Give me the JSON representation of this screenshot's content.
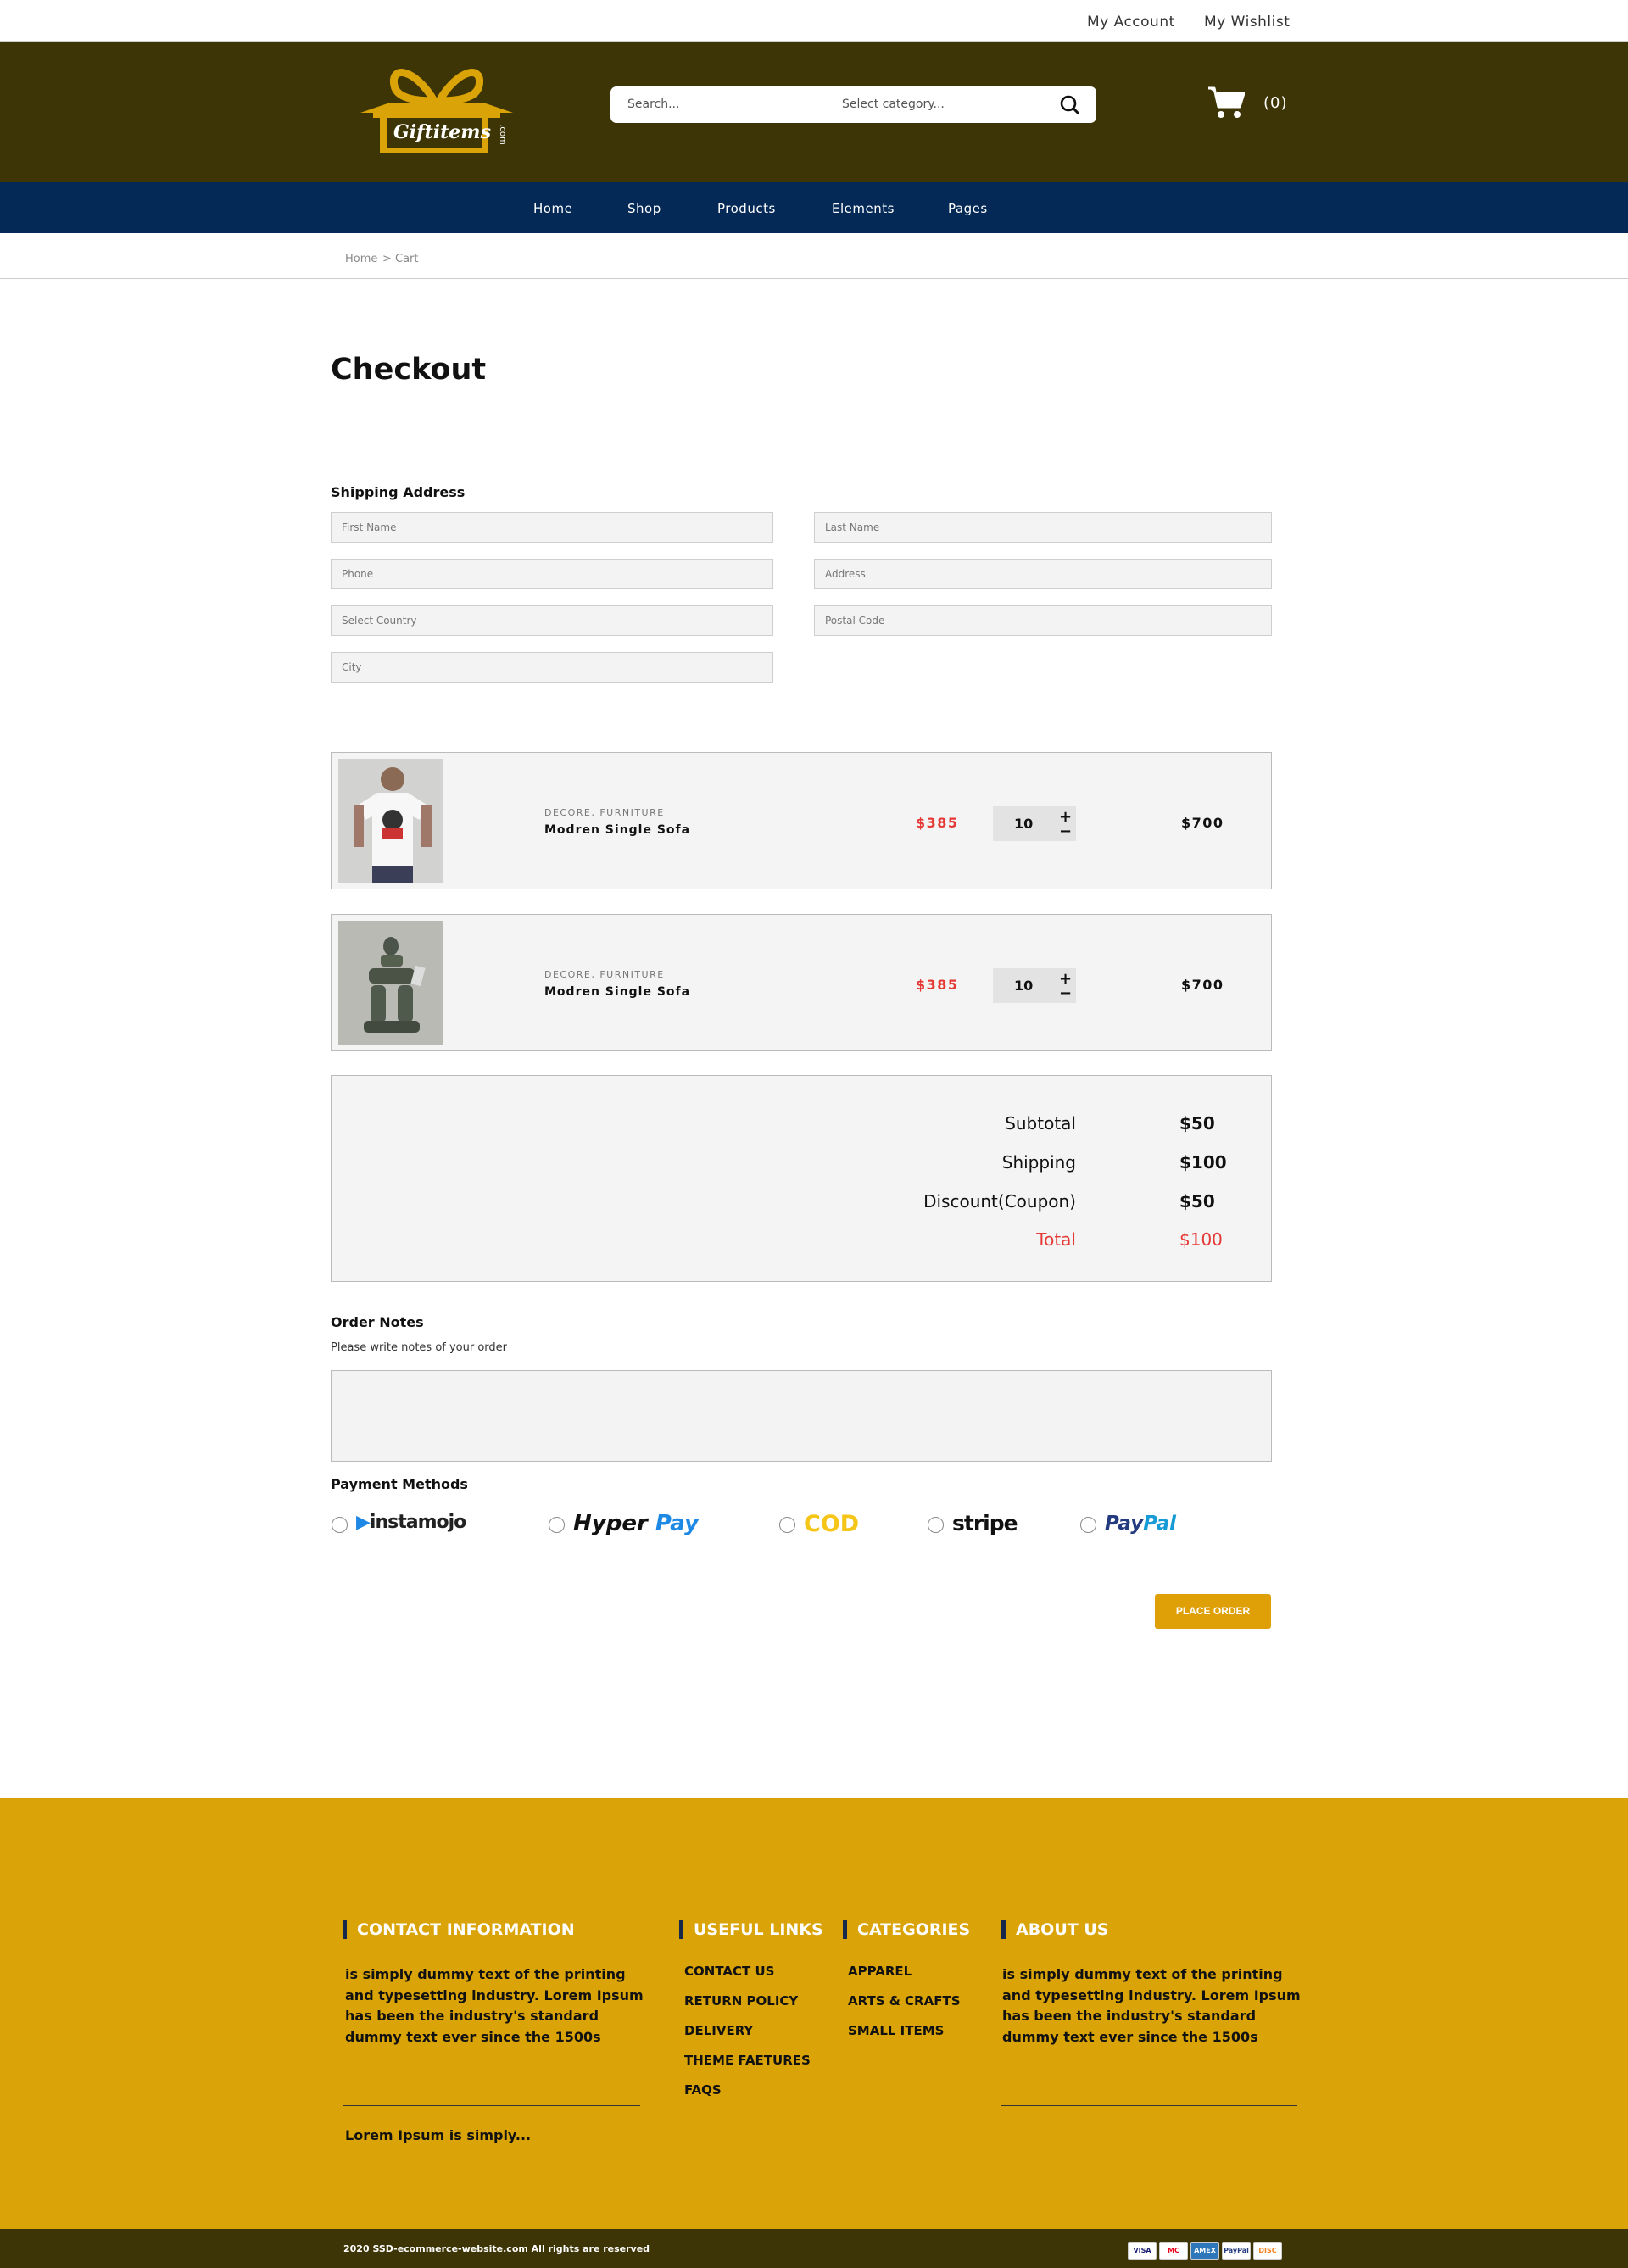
{
  "topbar": {
    "my_account": "My Account",
    "my_wishlist": "My Wishlist"
  },
  "header": {
    "logo_text": "Giftitems",
    "logo_sub": ".com",
    "search_placeholder": "Search...",
    "category_placeholder": "Select category...",
    "cart_count": "(0)"
  },
  "nav": {
    "items": [
      "Home",
      "Shop",
      "Products",
      "Elements",
      "Pages"
    ]
  },
  "breadcrumb": {
    "home": "Home",
    "sep": ">",
    "current": "Cart"
  },
  "page_title": "Checkout",
  "shipping": {
    "label": "Shipping Address",
    "first_name": "First Name",
    "last_name": "Last Name",
    "phone": "Phone",
    "address": "Address",
    "country": "Select Country",
    "postal": "Postal Code",
    "city": "City"
  },
  "items": [
    {
      "category": "DECORE, FURNITURE",
      "name": "Modren Single Sofa",
      "price": "$385",
      "qty": "10",
      "total": "$700"
    },
    {
      "category": "DECORE, FURNITURE",
      "name": "Modren Single Sofa",
      "price": "$385",
      "qty": "10",
      "total": "$700"
    }
  ],
  "qty_controls": {
    "plus": "+",
    "minus": "−"
  },
  "summary": {
    "subtotal_label": "Subtotal",
    "subtotal": "$50",
    "shipping_label": "Shipping",
    "shipping": "$100",
    "discount_label": "Discount(Coupon)",
    "discount": "$50",
    "total_label": "Total",
    "total": "$100"
  },
  "order_notes": {
    "label": "Order Notes",
    "hint": "Please write notes of your order"
  },
  "payment": {
    "label": "Payment Methods",
    "methods": [
      "instamojo",
      "Hyper",
      "Pay",
      "COD",
      "stripe",
      "Pay",
      "Pal"
    ]
  },
  "place_order": "PLACE ORDER",
  "footer": {
    "contact_title": "CONTACT INFORMATION",
    "contact_text": "is simply dummy text of the printing and typesetting industry. Lorem Ipsum has been the industry's standard dummy text ever since the 1500s",
    "contact_extra": "Lorem Ipsum is simply...",
    "links_title": "USEFUL LINKS",
    "links": [
      "CONTACT US",
      "RETURN POLICY",
      "DELIVERY",
      "THEME FAETURES",
      "FAQS"
    ],
    "categories_title": "CATEGORIES",
    "categories": [
      "APPAREL",
      "ARTS & CRAFTS",
      "SMALL ITEMS"
    ],
    "about_title": "ABOUT US",
    "about_text": "is simply dummy text of the printing and typesetting industry. Lorem Ipsum has been the industry's standard dummy text ever since the 1500s",
    "copyright": "2020 SSD-ecommerce-website.com All rights are reserved",
    "cards": [
      "VISA",
      "MC",
      "AMEX",
      "PayPal",
      "DISC"
    ]
  },
  "colors": {
    "header_bg": "#3d3505",
    "nav_bg": "#052957",
    "accent": "#dea006",
    "footer_bg": "#daa307",
    "price_red": "#e53935"
  }
}
